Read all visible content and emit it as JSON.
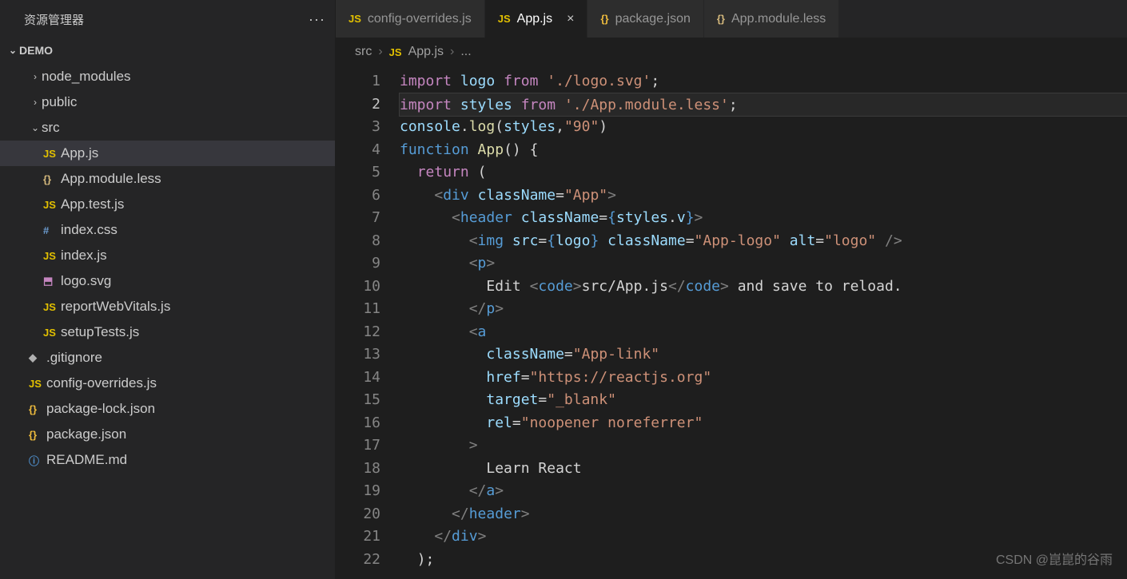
{
  "explorer": {
    "title": "资源管理器",
    "project": "DEMO",
    "tree": [
      {
        "kind": "folder",
        "label": "node_modules",
        "indent": 1,
        "open": false
      },
      {
        "kind": "folder",
        "label": "public",
        "indent": 1,
        "open": false
      },
      {
        "kind": "folder",
        "label": "src",
        "indent": 1,
        "open": true
      },
      {
        "kind": "file",
        "label": "App.js",
        "icon": "JS",
        "iconClass": "ic-js",
        "indent": 2,
        "selected": true
      },
      {
        "kind": "file",
        "label": "App.module.less",
        "icon": "{}",
        "iconClass": "ic-less",
        "indent": 2
      },
      {
        "kind": "file",
        "label": "App.test.js",
        "icon": "JS",
        "iconClass": "ic-js",
        "indent": 2
      },
      {
        "kind": "file",
        "label": "index.css",
        "icon": "#",
        "iconClass": "ic-hash",
        "indent": 2
      },
      {
        "kind": "file",
        "label": "index.js",
        "icon": "JS",
        "iconClass": "ic-js",
        "indent": 2
      },
      {
        "kind": "file",
        "label": "logo.svg",
        "icon": "⬒",
        "iconClass": "ic-svg",
        "indent": 2
      },
      {
        "kind": "file",
        "label": "reportWebVitals.js",
        "icon": "JS",
        "iconClass": "ic-js",
        "indent": 2
      },
      {
        "kind": "file",
        "label": "setupTests.js",
        "icon": "JS",
        "iconClass": "ic-js",
        "indent": 2
      },
      {
        "kind": "file",
        "label": ".gitignore",
        "icon": "◆",
        "iconClass": "ic-git",
        "indent": 1
      },
      {
        "kind": "file",
        "label": "config-overrides.js",
        "icon": "JS",
        "iconClass": "ic-js",
        "indent": 1
      },
      {
        "kind": "file",
        "label": "package-lock.json",
        "icon": "{}",
        "iconClass": "ic-json",
        "indent": 1
      },
      {
        "kind": "file",
        "label": "package.json",
        "icon": "{}",
        "iconClass": "ic-json",
        "indent": 1
      },
      {
        "kind": "file",
        "label": "README.md",
        "icon": "ⓘ",
        "iconClass": "ic-md",
        "indent": 1
      }
    ]
  },
  "tabs": [
    {
      "label": "config-overrides.js",
      "icon": "JS",
      "iconClass": "ic-js",
      "active": false
    },
    {
      "label": "App.js",
      "icon": "JS",
      "iconClass": "ic-js",
      "active": true
    },
    {
      "label": "package.json",
      "icon": "{}",
      "iconClass": "ic-json",
      "active": false
    },
    {
      "label": "App.module.less",
      "icon": "{}",
      "iconClass": "ic-less",
      "active": false
    }
  ],
  "breadcrumb": {
    "seg0": "src",
    "seg1_icon": "JS",
    "seg1": "App.js",
    "tail": "..."
  },
  "code": {
    "currentLine": 2,
    "lines": [
      [
        [
          "kw",
          "import"
        ],
        [
          "sp",
          " "
        ],
        [
          "var",
          "logo"
        ],
        [
          "sp",
          " "
        ],
        [
          "kw",
          "from"
        ],
        [
          "sp",
          " "
        ],
        [
          "str",
          "'./logo.svg'"
        ],
        [
          "pun",
          ";"
        ]
      ],
      [
        [
          "kw",
          "import"
        ],
        [
          "sp",
          " "
        ],
        [
          "var",
          "styles"
        ],
        [
          "sp",
          " "
        ],
        [
          "kw",
          "from"
        ],
        [
          "sp",
          " "
        ],
        [
          "str",
          "'./App.module.less'"
        ],
        [
          "pun",
          ";"
        ]
      ],
      [
        [
          "var",
          "console"
        ],
        [
          "pun",
          "."
        ],
        [
          "fn",
          "log"
        ],
        [
          "pun",
          "("
        ],
        [
          "var",
          "styles"
        ],
        [
          "pun",
          ","
        ],
        [
          "str",
          "\"90\""
        ],
        [
          "pun",
          ")"
        ]
      ],
      [
        [
          "type",
          "function"
        ],
        [
          "sp",
          " "
        ],
        [
          "fn",
          "App"
        ],
        [
          "pun",
          "()"
        ],
        [
          "sp",
          " "
        ],
        [
          "pun",
          "{"
        ]
      ],
      [
        [
          "sp",
          "  "
        ],
        [
          "kw",
          "return"
        ],
        [
          "sp",
          " "
        ],
        [
          "pun",
          "("
        ]
      ],
      [
        [
          "sp",
          "    "
        ],
        [
          "br",
          "<"
        ],
        [
          "tag",
          "div"
        ],
        [
          "sp",
          " "
        ],
        [
          "var",
          "className"
        ],
        [
          "pun",
          "="
        ],
        [
          "str",
          "\"App\""
        ],
        [
          "br",
          ">"
        ]
      ],
      [
        [
          "sp",
          "      "
        ],
        [
          "br",
          "<"
        ],
        [
          "tag",
          "header"
        ],
        [
          "sp",
          " "
        ],
        [
          "var",
          "className"
        ],
        [
          "pun",
          "="
        ],
        [
          "type",
          "{"
        ],
        [
          "var",
          "styles"
        ],
        [
          "pun",
          "."
        ],
        [
          "var",
          "v"
        ],
        [
          "type",
          "}"
        ],
        [
          "br",
          ">"
        ]
      ],
      [
        [
          "sp",
          "        "
        ],
        [
          "br",
          "<"
        ],
        [
          "tag",
          "img"
        ],
        [
          "sp",
          " "
        ],
        [
          "var",
          "src"
        ],
        [
          "pun",
          "="
        ],
        [
          "type",
          "{"
        ],
        [
          "var",
          "logo"
        ],
        [
          "type",
          "}"
        ],
        [
          "sp",
          " "
        ],
        [
          "var",
          "className"
        ],
        [
          "pun",
          "="
        ],
        [
          "str",
          "\"App-logo\""
        ],
        [
          "sp",
          " "
        ],
        [
          "var",
          "alt"
        ],
        [
          "pun",
          "="
        ],
        [
          "str",
          "\"logo\""
        ],
        [
          "sp",
          " "
        ],
        [
          "br",
          "/>"
        ]
      ],
      [
        [
          "sp",
          "        "
        ],
        [
          "br",
          "<"
        ],
        [
          "tag",
          "p"
        ],
        [
          "br",
          ">"
        ]
      ],
      [
        [
          "sp",
          "          "
        ],
        [
          "pun",
          "Edit "
        ],
        [
          "br",
          "<"
        ],
        [
          "tag",
          "code"
        ],
        [
          "br",
          ">"
        ],
        [
          "pun",
          "src/App.js"
        ],
        [
          "br",
          "</"
        ],
        [
          "tag",
          "code"
        ],
        [
          "br",
          ">"
        ],
        [
          "pun",
          " and save to reload."
        ]
      ],
      [
        [
          "sp",
          "        "
        ],
        [
          "br",
          "</"
        ],
        [
          "tag",
          "p"
        ],
        [
          "br",
          ">"
        ]
      ],
      [
        [
          "sp",
          "        "
        ],
        [
          "br",
          "<"
        ],
        [
          "tag",
          "a"
        ]
      ],
      [
        [
          "sp",
          "          "
        ],
        [
          "var",
          "className"
        ],
        [
          "pun",
          "="
        ],
        [
          "str",
          "\"App-link\""
        ]
      ],
      [
        [
          "sp",
          "          "
        ],
        [
          "var",
          "href"
        ],
        [
          "pun",
          "="
        ],
        [
          "str",
          "\"https://reactjs.org\""
        ]
      ],
      [
        [
          "sp",
          "          "
        ],
        [
          "var",
          "target"
        ],
        [
          "pun",
          "="
        ],
        [
          "str",
          "\"_blank\""
        ]
      ],
      [
        [
          "sp",
          "          "
        ],
        [
          "var",
          "rel"
        ],
        [
          "pun",
          "="
        ],
        [
          "str",
          "\"noopener noreferrer\""
        ]
      ],
      [
        [
          "sp",
          "        "
        ],
        [
          "br",
          ">"
        ]
      ],
      [
        [
          "sp",
          "          "
        ],
        [
          "pun",
          "Learn React"
        ]
      ],
      [
        [
          "sp",
          "        "
        ],
        [
          "br",
          "</"
        ],
        [
          "tag",
          "a"
        ],
        [
          "br",
          ">"
        ]
      ],
      [
        [
          "sp",
          "      "
        ],
        [
          "br",
          "</"
        ],
        [
          "tag",
          "header"
        ],
        [
          "br",
          ">"
        ]
      ],
      [
        [
          "sp",
          "    "
        ],
        [
          "br",
          "</"
        ],
        [
          "tag",
          "div"
        ],
        [
          "br",
          ">"
        ]
      ],
      [
        [
          "sp",
          "  "
        ],
        [
          "pun",
          ");"
        ]
      ]
    ]
  },
  "watermark": "CSDN @崑崑的谷雨"
}
